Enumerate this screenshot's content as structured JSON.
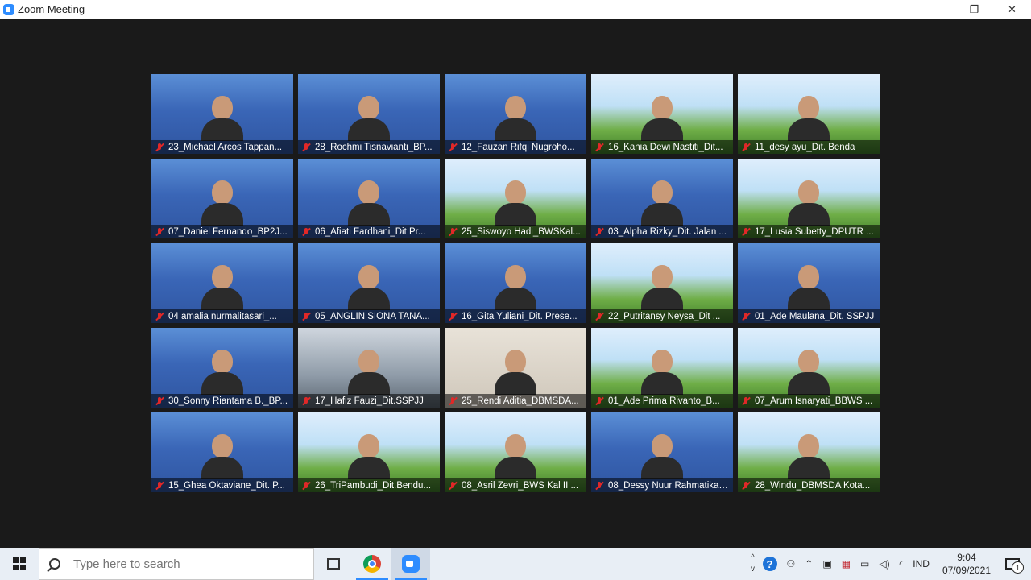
{
  "window": {
    "title": "Zoom Meeting",
    "minimize": "—",
    "restore": "❐",
    "close": "✕"
  },
  "participants": [
    {
      "name": "23_Michael Arcos Tappan...",
      "bg": "bridge"
    },
    {
      "name": "28_Rochmi Tisnavianti_BP...",
      "bg": "bridge"
    },
    {
      "name": "12_Fauzan Rifqi Nugroho...",
      "bg": "bridge"
    },
    {
      "name": "16_Kania Dewi Nastiti_Dit...",
      "bg": "green"
    },
    {
      "name": "11_desy ayu_Dit. Benda",
      "bg": "green"
    },
    {
      "name": "07_Daniel Fernando_BP2J...",
      "bg": "bridge"
    },
    {
      "name": "06_Afiati Fardhani_Dit Pr...",
      "bg": "bridge"
    },
    {
      "name": "25_Siswoyo Hadi_BWSKal...",
      "bg": "green"
    },
    {
      "name": "03_Alpha Rizky_Dit. Jalan ...",
      "bg": "bridge"
    },
    {
      "name": "17_Lusia Subetty_DPUTR ...",
      "bg": "green"
    },
    {
      "name": "04 amalia nurmalitasari_...",
      "bg": "bridge"
    },
    {
      "name": "05_ANGLIN SIONA TANA...",
      "bg": "bridge"
    },
    {
      "name": "16_Gita Yuliani_Dit. Prese...",
      "bg": "bridge"
    },
    {
      "name": "22_Putritansy Neysa_Dit ...",
      "bg": "green"
    },
    {
      "name": "01_Ade Maulana_Dit. SSPJJ",
      "bg": "bridge"
    },
    {
      "name": "30_Sonny Riantama B._BP...",
      "bg": "bridge"
    },
    {
      "name": "17_Hafiz Fauzi_Dit.SSPJJ",
      "bg": "office"
    },
    {
      "name": "25_Rendi Aditia_DBMSDA...",
      "bg": "room"
    },
    {
      "name": "01_Ade Prima Rivanto_B...",
      "bg": "green"
    },
    {
      "name": "07_Arum Isnaryati_BBWS ...",
      "bg": "green"
    },
    {
      "name": "15_Ghea Oktaviane_Dit. P...",
      "bg": "bridge"
    },
    {
      "name": "26_TriPambudi_Dit.Bendu...",
      "bg": "green"
    },
    {
      "name": "08_Asril Zevri_BWS Kal II ...",
      "bg": "green"
    },
    {
      "name": "08_Dessy Nuur Rahmatika_D...",
      "bg": "bridge"
    },
    {
      "name": "28_Windu_DBMSDA Kota...",
      "bg": "green"
    }
  ],
  "taskbar": {
    "search_placeholder": "Type here to search",
    "language": "IND",
    "time": "9:04",
    "date": "07/09/2021",
    "notification_count": "1",
    "scroll_up": "^",
    "scroll_down": "v",
    "help": "?"
  }
}
